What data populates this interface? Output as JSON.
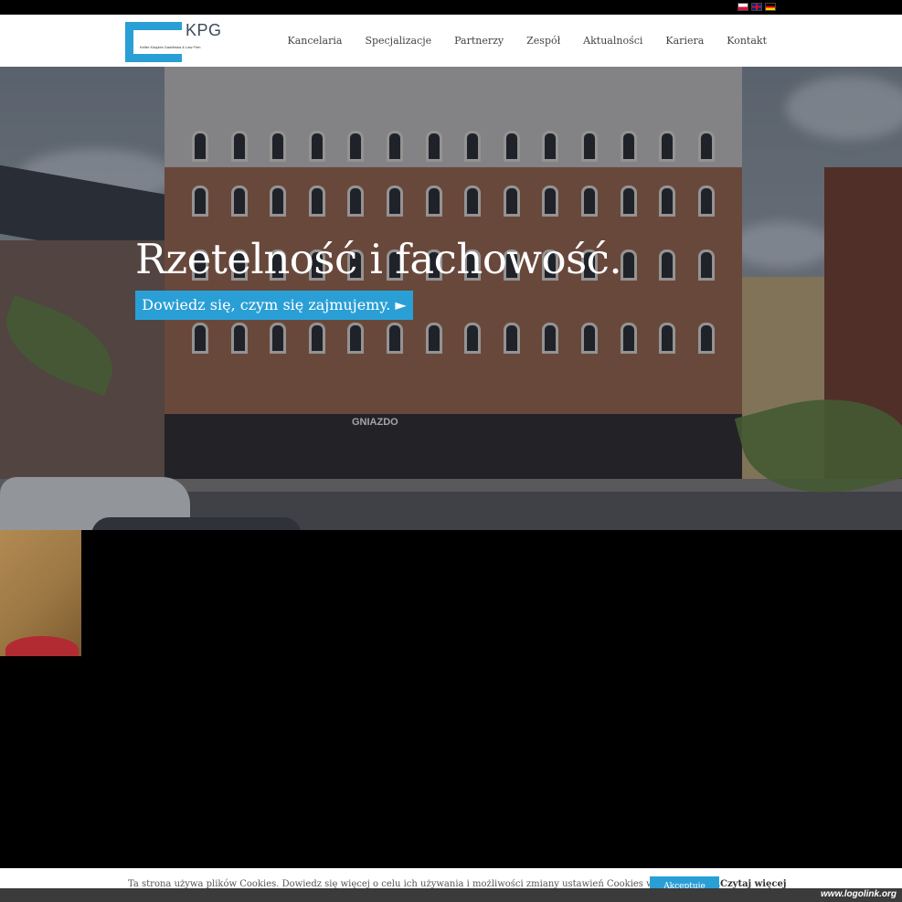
{
  "languages": [
    {
      "code": "pl",
      "icon": "flag-pl-icon"
    },
    {
      "code": "en",
      "icon": "flag-gb-icon"
    },
    {
      "code": "de",
      "icon": "flag-de-icon"
    }
  ],
  "logo": {
    "text": "KPG",
    "subtitle": "Kelter Książek Gawlińska & Law Firm",
    "accent": "#2a9fd6"
  },
  "nav": {
    "items": [
      "Kancelaria",
      "Specjalizacje",
      "Partnerzy",
      "Zespół",
      "Aktualności",
      "Kariera",
      "Kontakt"
    ]
  },
  "hero": {
    "title": "Rzetelność i fachowość.",
    "cta": "Dowiedz się, czym się zajmujemy. ►",
    "storefront_sign": "GNIAZDO"
  },
  "cookie": {
    "text": "Ta strona używa plików Cookies. Dowiedz się więcej o celu ich używania i możliwości zmiany ustawień Cookies w przeglądarce.",
    "accept": "Akceptuję",
    "more": "Czytaj więcej"
  },
  "watermark": "www.logolink.org",
  "colors": {
    "accent": "#2a9fd6",
    "nav_text": "#444444",
    "header_bg": "#ffffff"
  }
}
